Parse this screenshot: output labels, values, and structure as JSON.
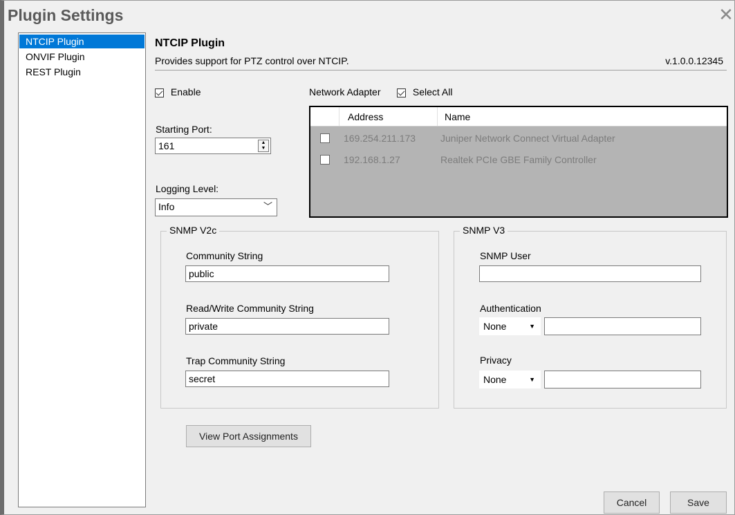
{
  "window": {
    "title": "Plugin Settings"
  },
  "sidebar": {
    "items": [
      {
        "label": "NTCIP Plugin",
        "selected": true
      },
      {
        "label": "ONVIF Plugin",
        "selected": false
      },
      {
        "label": "REST Plugin",
        "selected": false
      }
    ]
  },
  "plugin": {
    "title": "NTCIP Plugin",
    "description": "Provides support for PTZ control over NTCIP.",
    "version": "v.1.0.0.12345"
  },
  "enable": {
    "label": "Enable",
    "checked": true
  },
  "starting_port": {
    "label": "Starting Port:",
    "value": "161"
  },
  "logging_level": {
    "label": "Logging Level:",
    "value": "Info"
  },
  "network_adapter": {
    "label": "Network Adapter",
    "select_all_label": "Select All",
    "select_all_checked": true,
    "columns": [
      "Address",
      "Name"
    ],
    "rows": [
      {
        "address": "169.254.211.173",
        "name": "Juniper Network Connect Virtual Adapter",
        "checked": false
      },
      {
        "address": "192.168.1.27",
        "name": "Realtek PCIe GBE Family Controller",
        "checked": false
      }
    ]
  },
  "snmp_v2c": {
    "legend": "SNMP V2c",
    "community_label": "Community String",
    "community_value": "public",
    "rw_label": "Read/Write Community String",
    "rw_value": "private",
    "trap_label": "Trap Community String",
    "trap_value": "secret"
  },
  "snmp_v3": {
    "legend": "SNMP V3",
    "user_label": "SNMP User",
    "user_value": "",
    "auth_label": "Authentication",
    "auth_value": "None",
    "auth_key": "",
    "privacy_label": "Privacy",
    "privacy_value": "None",
    "privacy_key": ""
  },
  "buttons": {
    "view_ports": "View Port Assignments",
    "cancel": "Cancel",
    "save": "Save"
  },
  "colors": {
    "selection": "#0078d7",
    "list_bg": "#b4b4b4",
    "disabled_text": "#7c7c7c"
  }
}
